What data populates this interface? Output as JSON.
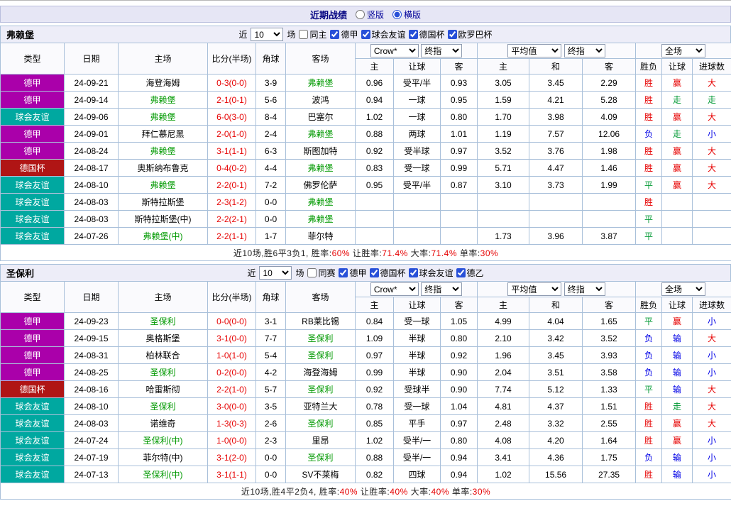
{
  "topbar": {
    "title": "近期战绩",
    "layout_options": [
      {
        "label": "竖版",
        "selected": false
      },
      {
        "label": "横版",
        "selected": true
      }
    ]
  },
  "columns": {
    "type": "类型",
    "date": "日期",
    "home": "主场",
    "score": "比分(半场)",
    "corners": "角球",
    "away": "客场",
    "odds_dd1": "Crow*",
    "odds_dd2": "终指",
    "avg_dd1": "平均值",
    "avg_dd2": "终指",
    "scope_dd": "全场",
    "sub_home": "主",
    "sub_handicap": "让球",
    "sub_away": "客",
    "sub_avg_home": "主",
    "sub_draw": "和",
    "sub_avg_away": "客",
    "sub_result": "胜负",
    "sub_handicap2": "让球",
    "sub_goals": "进球数"
  },
  "league_colors": {
    "德甲": "#aa00aa",
    "球会友谊": "#00a8a0",
    "德国杯": "#b01515",
    "德乙": "#aa00aa"
  },
  "sections": [
    {
      "team": "弗赖堡",
      "filters": {
        "prefix": "近",
        "count": "10",
        "suffix": "场",
        "same_label": "同主",
        "same_checked": false,
        "leagues": [
          "德甲",
          "球会友谊",
          "德国杯",
          "欧罗巴杯"
        ]
      },
      "rows": [
        {
          "league": "德甲",
          "date": "24-09-21",
          "home": "海登海姆",
          "home_focus": false,
          "score": "0-3(0-0)",
          "corners": "3-9",
          "away": "弗赖堡",
          "away_focus": true,
          "odds": [
            "0.96",
            "受平/半",
            "0.93"
          ],
          "avg": [
            "3.05",
            "3.45",
            "2.29"
          ],
          "results": [
            [
              "胜",
              "r"
            ],
            [
              "赢",
              "r"
            ],
            [
              "大",
              "r"
            ]
          ]
        },
        {
          "league": "德甲",
          "date": "24-09-14",
          "home": "弗赖堡",
          "home_focus": true,
          "score": "2-1(0-1)",
          "corners": "5-6",
          "away": "波鸿",
          "away_focus": false,
          "odds": [
            "0.94",
            "一球",
            "0.95"
          ],
          "avg": [
            "1.59",
            "4.21",
            "5.28"
          ],
          "results": [
            [
              "胜",
              "r"
            ],
            [
              "走",
              "g"
            ],
            [
              "走",
              "g"
            ]
          ]
        },
        {
          "league": "球会友谊",
          "date": "24-09-06",
          "home": "弗赖堡",
          "home_focus": true,
          "score": "6-0(3-0)",
          "corners": "8-4",
          "away": "巴塞尔",
          "away_focus": false,
          "odds": [
            "1.02",
            "一球",
            "0.80"
          ],
          "avg": [
            "1.70",
            "3.98",
            "4.09"
          ],
          "results": [
            [
              "胜",
              "r"
            ],
            [
              "赢",
              "r"
            ],
            [
              "大",
              "r"
            ]
          ]
        },
        {
          "league": "德甲",
          "date": "24-09-01",
          "home": "拜仁慕尼黑",
          "home_focus": false,
          "score": "2-0(1-0)",
          "corners": "2-4",
          "away": "弗赖堡",
          "away_focus": true,
          "odds": [
            "0.88",
            "两球",
            "1.01"
          ],
          "avg": [
            "1.19",
            "7.57",
            "12.06"
          ],
          "results": [
            [
              "负",
              "b"
            ],
            [
              "走",
              "g"
            ],
            [
              "小",
              "b"
            ]
          ]
        },
        {
          "league": "德甲",
          "date": "24-08-24",
          "home": "弗赖堡",
          "home_focus": true,
          "score": "3-1(1-1)",
          "corners": "6-3",
          "away": "斯图加特",
          "away_focus": false,
          "odds": [
            "0.92",
            "受半球",
            "0.97"
          ],
          "avg": [
            "3.52",
            "3.76",
            "1.98"
          ],
          "results": [
            [
              "胜",
              "r"
            ],
            [
              "赢",
              "r"
            ],
            [
              "大",
              "r"
            ]
          ]
        },
        {
          "league": "德国杯",
          "date": "24-08-17",
          "home": "奥斯纳布鲁克",
          "home_focus": false,
          "score": "0-4(0-2)",
          "corners": "4-4",
          "away": "弗赖堡",
          "away_focus": true,
          "odds": [
            "0.83",
            "受一球",
            "0.99"
          ],
          "avg": [
            "5.71",
            "4.47",
            "1.46"
          ],
          "results": [
            [
              "胜",
              "r"
            ],
            [
              "赢",
              "r"
            ],
            [
              "大",
              "r"
            ]
          ]
        },
        {
          "league": "球会友谊",
          "date": "24-08-10",
          "home": "弗赖堡",
          "home_focus": true,
          "score": "2-2(0-1)",
          "corners": "7-2",
          "away": "佛罗伦萨",
          "away_focus": false,
          "odds": [
            "0.95",
            "受平/半",
            "0.87"
          ],
          "avg": [
            "3.10",
            "3.73",
            "1.99"
          ],
          "results": [
            [
              "平",
              "g"
            ],
            [
              "赢",
              "r"
            ],
            [
              "大",
              "r"
            ]
          ]
        },
        {
          "league": "球会友谊",
          "date": "24-08-03",
          "home": "斯特拉斯堡",
          "home_focus": false,
          "score": "2-3(1-2)",
          "corners": "0-0",
          "away": "弗赖堡",
          "away_focus": true,
          "odds": [
            "",
            "",
            ""
          ],
          "avg": [
            "",
            "",
            ""
          ],
          "results": [
            [
              "胜",
              "r"
            ],
            [
              "",
              ""
            ],
            [
              "",
              ""
            ]
          ]
        },
        {
          "league": "球会友谊",
          "date": "24-08-03",
          "home": "斯特拉斯堡(中)",
          "home_focus": false,
          "score": "2-2(2-1)",
          "corners": "0-0",
          "away": "弗赖堡",
          "away_focus": true,
          "odds": [
            "",
            "",
            ""
          ],
          "avg": [
            "",
            "",
            ""
          ],
          "results": [
            [
              "平",
              "g"
            ],
            [
              "",
              ""
            ],
            [
              "",
              ""
            ]
          ]
        },
        {
          "league": "球会友谊",
          "date": "24-07-26",
          "home": "弗赖堡(中)",
          "home_focus": true,
          "score": "2-2(1-1)",
          "corners": "1-7",
          "away": "菲尔特",
          "away_focus": false,
          "odds": [
            "",
            "",
            ""
          ],
          "avg": [
            "1.73",
            "3.96",
            "3.87"
          ],
          "results": [
            [
              "平",
              "g"
            ],
            [
              "",
              ""
            ],
            [
              "",
              ""
            ]
          ]
        }
      ],
      "summary": [
        {
          "t": "近10场,胜6平3负1, 胜率:",
          "c": "k"
        },
        {
          "t": "60%",
          "c": "r"
        },
        {
          "t": " 让胜率:",
          "c": "k"
        },
        {
          "t": "71.4%",
          "c": "r"
        },
        {
          "t": " 大率:",
          "c": "k"
        },
        {
          "t": "71.4%",
          "c": "r"
        },
        {
          "t": " 单率:",
          "c": "k"
        },
        {
          "t": "30%",
          "c": "r"
        }
      ]
    },
    {
      "team": "圣保利",
      "filters": {
        "prefix": "近",
        "count": "10",
        "suffix": "场",
        "same_label": "同赛",
        "same_checked": false,
        "leagues": [
          "德甲",
          "德国杯",
          "球会友谊",
          "德乙"
        ]
      },
      "rows": [
        {
          "league": "德甲",
          "date": "24-09-23",
          "home": "圣保利",
          "home_focus": true,
          "score": "0-0(0-0)",
          "corners": "3-1",
          "away": "RB莱比锡",
          "away_focus": false,
          "odds": [
            "0.84",
            "受一球",
            "1.05"
          ],
          "avg": [
            "4.99",
            "4.04",
            "1.65"
          ],
          "results": [
            [
              "平",
              "g"
            ],
            [
              "赢",
              "r"
            ],
            [
              "小",
              "b"
            ]
          ]
        },
        {
          "league": "德甲",
          "date": "24-09-15",
          "home": "奥格斯堡",
          "home_focus": false,
          "score": "3-1(0-0)",
          "corners": "7-7",
          "away": "圣保利",
          "away_focus": true,
          "odds": [
            "1.09",
            "半球",
            "0.80"
          ],
          "avg": [
            "2.10",
            "3.42",
            "3.52"
          ],
          "results": [
            [
              "负",
              "b"
            ],
            [
              "输",
              "b"
            ],
            [
              "大",
              "r"
            ]
          ]
        },
        {
          "league": "德甲",
          "date": "24-08-31",
          "home": "柏林联合",
          "home_focus": false,
          "score": "1-0(1-0)",
          "corners": "5-4",
          "away": "圣保利",
          "away_focus": true,
          "odds": [
            "0.97",
            "半球",
            "0.92"
          ],
          "avg": [
            "1.96",
            "3.45",
            "3.93"
          ],
          "results": [
            [
              "负",
              "b"
            ],
            [
              "输",
              "b"
            ],
            [
              "小",
              "b"
            ]
          ]
        },
        {
          "league": "德甲",
          "date": "24-08-25",
          "home": "圣保利",
          "home_focus": true,
          "score": "0-2(0-0)",
          "corners": "4-2",
          "away": "海登海姆",
          "away_focus": false,
          "odds": [
            "0.99",
            "半球",
            "0.90"
          ],
          "avg": [
            "2.04",
            "3.51",
            "3.58"
          ],
          "results": [
            [
              "负",
              "b"
            ],
            [
              "输",
              "b"
            ],
            [
              "小",
              "b"
            ]
          ]
        },
        {
          "league": "德国杯",
          "date": "24-08-16",
          "home": "哈雷斯彻",
          "home_focus": false,
          "score": "2-2(1-0)",
          "corners": "5-7",
          "away": "圣保利",
          "away_focus": true,
          "odds": [
            "0.92",
            "受球半",
            "0.90"
          ],
          "avg": [
            "7.74",
            "5.12",
            "1.33"
          ],
          "results": [
            [
              "平",
              "g"
            ],
            [
              "输",
              "b"
            ],
            [
              "大",
              "r"
            ]
          ]
        },
        {
          "league": "球会友谊",
          "date": "24-08-10",
          "home": "圣保利",
          "home_focus": true,
          "score": "3-0(0-0)",
          "corners": "3-5",
          "away": "亚特兰大",
          "away_focus": false,
          "odds": [
            "0.78",
            "受一球",
            "1.04"
          ],
          "avg": [
            "4.81",
            "4.37",
            "1.51"
          ],
          "results": [
            [
              "胜",
              "r"
            ],
            [
              "走",
              "g"
            ],
            [
              "大",
              "r"
            ]
          ]
        },
        {
          "league": "球会友谊",
          "date": "24-08-03",
          "home": "诺维奇",
          "home_focus": false,
          "score": "1-3(0-3)",
          "corners": "2-6",
          "away": "圣保利",
          "away_focus": true,
          "odds": [
            "0.85",
            "平手",
            "0.97"
          ],
          "avg": [
            "2.48",
            "3.32",
            "2.55"
          ],
          "results": [
            [
              "胜",
              "r"
            ],
            [
              "赢",
              "r"
            ],
            [
              "大",
              "r"
            ]
          ]
        },
        {
          "league": "球会友谊",
          "date": "24-07-24",
          "home": "圣保利(中)",
          "home_focus": true,
          "score": "1-0(0-0)",
          "corners": "2-3",
          "away": "里昂",
          "away_focus": false,
          "odds": [
            "1.02",
            "受半/一",
            "0.80"
          ],
          "avg": [
            "4.08",
            "4.20",
            "1.64"
          ],
          "results": [
            [
              "胜",
              "r"
            ],
            [
              "赢",
              "r"
            ],
            [
              "小",
              "b"
            ]
          ]
        },
        {
          "league": "球会友谊",
          "date": "24-07-19",
          "home": "菲尔特(中)",
          "home_focus": false,
          "score": "3-1(2-0)",
          "corners": "0-0",
          "away": "圣保利",
          "away_focus": true,
          "odds": [
            "0.88",
            "受半/一",
            "0.94"
          ],
          "avg": [
            "3.41",
            "4.36",
            "1.75"
          ],
          "results": [
            [
              "负",
              "b"
            ],
            [
              "输",
              "b"
            ],
            [
              "小",
              "b"
            ]
          ]
        },
        {
          "league": "球会友谊",
          "date": "24-07-13",
          "home": "圣保利(中)",
          "home_focus": true,
          "score": "3-1(1-1)",
          "corners": "0-0",
          "away": "SV不莱梅",
          "away_focus": false,
          "odds": [
            "0.82",
            "四球",
            "0.94"
          ],
          "avg": [
            "1.02",
            "15.56",
            "27.35"
          ],
          "results": [
            [
              "胜",
              "r"
            ],
            [
              "输",
              "b"
            ],
            [
              "小",
              "b"
            ]
          ]
        }
      ],
      "summary": [
        {
          "t": "近10场,胜4平2负4, 胜率:",
          "c": "k"
        },
        {
          "t": "40%",
          "c": "r"
        },
        {
          "t": " 让胜率:",
          "c": "k"
        },
        {
          "t": "40%",
          "c": "r"
        },
        {
          "t": " 大率:",
          "c": "k"
        },
        {
          "t": "40%",
          "c": "r"
        },
        {
          "t": " 单率:",
          "c": "k"
        },
        {
          "t": "30%",
          "c": "r"
        }
      ]
    }
  ]
}
